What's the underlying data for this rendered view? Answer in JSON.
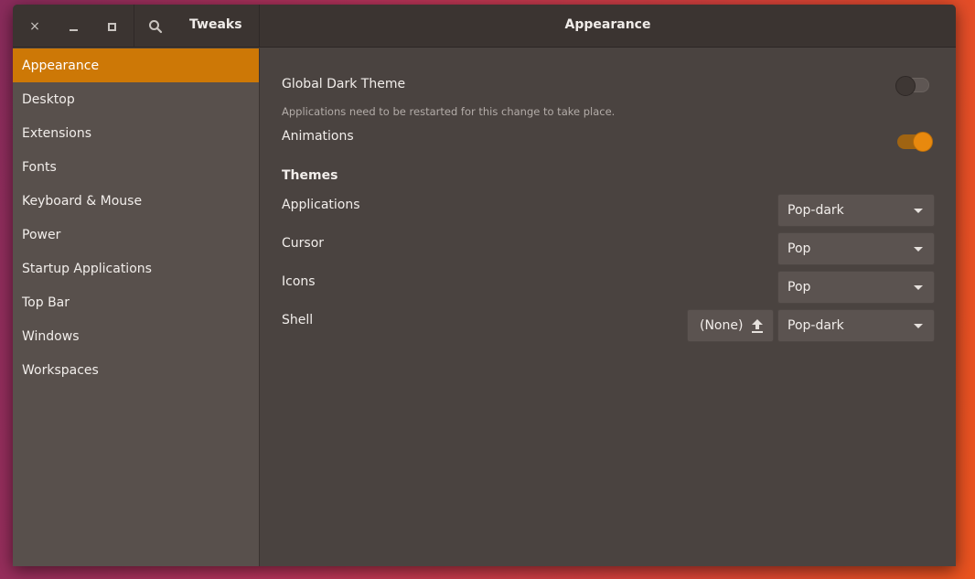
{
  "titlebar": {
    "app_title": "Tweaks",
    "page_title": "Appearance",
    "close_glyph": "×"
  },
  "sidebar": {
    "items": [
      {
        "label": "Appearance",
        "active": true
      },
      {
        "label": "Desktop"
      },
      {
        "label": "Extensions"
      },
      {
        "label": "Fonts"
      },
      {
        "label": "Keyboard & Mouse"
      },
      {
        "label": "Power"
      },
      {
        "label": "Startup Applications"
      },
      {
        "label": "Top Bar"
      },
      {
        "label": "Windows"
      },
      {
        "label": "Workspaces"
      }
    ]
  },
  "appearance": {
    "global_dark_theme": {
      "label": "Global Dark Theme",
      "note": "Applications need to be restarted for this change to take place.",
      "enabled": false
    },
    "animations": {
      "label": "Animations",
      "enabled": true
    },
    "themes_heading": "Themes",
    "applications": {
      "label": "Applications",
      "value": "Pop-dark"
    },
    "cursor": {
      "label": "Cursor",
      "value": "Pop"
    },
    "icons": {
      "label": "Icons",
      "value": "Pop"
    },
    "shell": {
      "label": "Shell",
      "file_value": "(None)",
      "value": "Pop-dark"
    }
  },
  "colors": {
    "accent": "#cd7806",
    "sidebar_bg": "#58504c",
    "content_bg": "#4a4340",
    "titlebar_bg": "#3b3431"
  },
  "icons": [
    "close-icon",
    "minimize-icon",
    "maximize-icon",
    "search-icon",
    "upload-icon",
    "chevron-down-icon"
  ]
}
